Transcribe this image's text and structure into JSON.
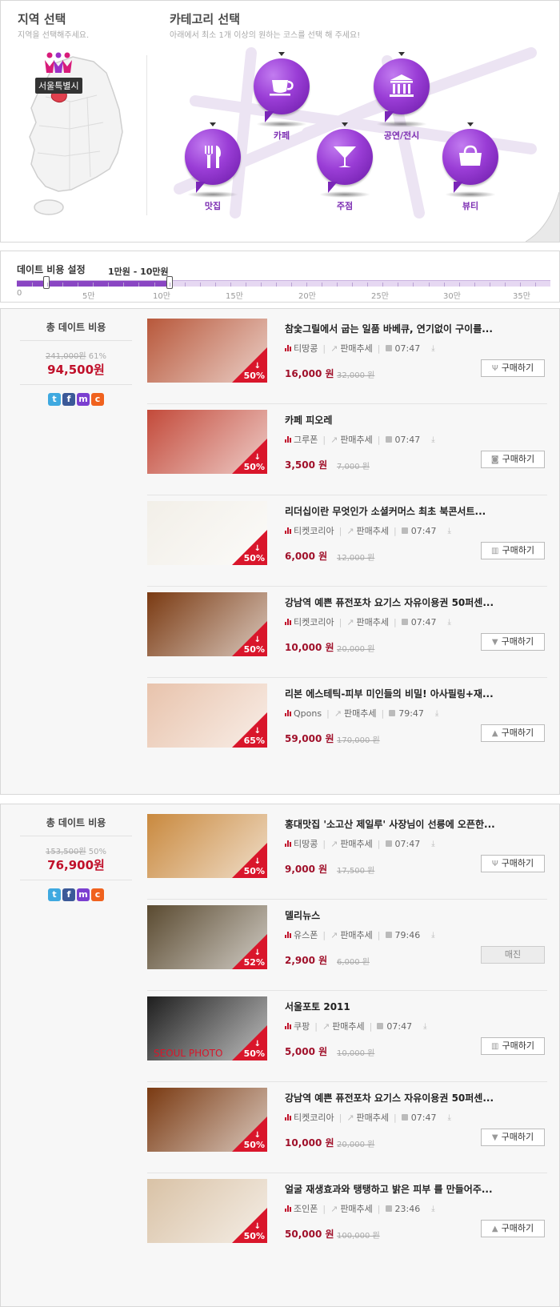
{
  "region": {
    "title": "지역 선택",
    "subtitle": "지역을 선택해주세요.",
    "selected": "서울특별시"
  },
  "category": {
    "title": "카테고리 선택",
    "subtitle": "아래에서 최소 1개 이상의 원하는 코스를 선택 해 주세요!",
    "items": [
      {
        "label": "맛집",
        "icon": "fork-knife-icon"
      },
      {
        "label": "카페",
        "icon": "coffee-cup-icon"
      },
      {
        "label": "주점",
        "icon": "cocktail-glass-icon"
      },
      {
        "label": "공연/전시",
        "icon": "museum-icon"
      },
      {
        "label": "뷰티",
        "icon": "handbag-icon"
      }
    ]
  },
  "cost": {
    "title": "데이트 비용 설정",
    "range": "1만원 - 10만원",
    "scale": [
      "0",
      "5만",
      "10만",
      "15만",
      "20만",
      "25만",
      "30만",
      "35만"
    ],
    "min_value": 1,
    "max_value": 10,
    "scale_max": 35
  },
  "courses": [
    {
      "summary_title": "총 데이트 비용",
      "original_total": "241,000원",
      "discount": "61%",
      "total": "94,500원",
      "deals": [
        {
          "title": "참숯그릴에서 굽는 일품 바베큐, 연기없이 구이를...",
          "source": "티땅콩",
          "trend": "판매추세",
          "time": "07:47",
          "price": "16,000 원",
          "original": "32,000 원",
          "discount": "50%",
          "button": "구매하기",
          "cat_icon": "fork-knife-icon",
          "thumb_color": "#b8583b",
          "sold_out": false
        },
        {
          "title": "카페 피오레",
          "source": "그루폰",
          "trend": "판매추세",
          "time": "07:47",
          "price": "3,500 원",
          "original": "7,000 원",
          "discount": "50%",
          "button": "구매하기",
          "cat_icon": "coffee-cup-icon",
          "thumb_color": "#c34a3a",
          "sold_out": false
        },
        {
          "title": "리더십이란 무엇인가 소셜커머스 최초 북콘서트...",
          "source": "티켓코리아",
          "trend": "판매추세",
          "time": "07:47",
          "price": "6,000 원",
          "original": "12,000 원",
          "discount": "50%",
          "button": "구매하기",
          "cat_icon": "museum-icon",
          "thumb_color": "#f2efe8",
          "sold_out": false
        },
        {
          "title": "강남역 예쁜 퓨전포차 요기스 자유이용권 50퍼센...",
          "source": "티켓코리아",
          "trend": "판매추세",
          "time": "07:47",
          "price": "10,000 원",
          "original": "20,000 원",
          "discount": "50%",
          "button": "구매하기",
          "cat_icon": "cocktail-glass-icon",
          "thumb_color": "#7a3a12",
          "sold_out": false
        },
        {
          "title": "리본 에스테틱-피부 미인들의 비밀! 아사필링+재...",
          "source": "Qpons",
          "trend": "판매추세",
          "time": "79:47",
          "price": "59,000 원",
          "original": "170,000 원",
          "discount": "65%",
          "button": "구매하기",
          "cat_icon": "handbag-icon",
          "thumb_color": "#e8c3ac",
          "sold_out": false
        }
      ]
    },
    {
      "summary_title": "총 데이트 비용",
      "original_total": "153,500원",
      "discount": "50%",
      "total": "76,900원",
      "deals": [
        {
          "title": "홍대맛집 '소고산 제일루' 사장님이 선릉에 오픈한...",
          "source": "티땅콩",
          "trend": "판매추세",
          "time": "07:47",
          "price": "9,000 원",
          "original": "17,500 원",
          "discount": "50%",
          "button": "구매하기",
          "cat_icon": "fork-knife-icon",
          "thumb_color": "#c9893e",
          "sold_out": false
        },
        {
          "title": "델리뉴스",
          "source": "유스폰",
          "trend": "판매추세",
          "time": "79:46",
          "price": "2,900 원",
          "original": "6,000 원",
          "discount": "52%",
          "button": "매진",
          "cat_icon": "coffee-cup-icon",
          "thumb_color": "#5a4a30",
          "sold_out": true
        },
        {
          "title": "서울포토 2011",
          "source": "쿠팡",
          "trend": "판매추세",
          "time": "07:47",
          "price": "5,000 원",
          "original": "10,000 원",
          "discount": "50%",
          "button": "구매하기",
          "cat_icon": "museum-icon",
          "thumb_color": "#1e1e1e",
          "thumb_text": "SEOUL PHOTO",
          "sold_out": false
        },
        {
          "title": "강남역 예쁜 퓨전포차 요기스 자유이용권 50퍼센...",
          "source": "티켓코리아",
          "trend": "판매추세",
          "time": "07:47",
          "price": "10,000 원",
          "original": "20,000 원",
          "discount": "50%",
          "button": "구매하기",
          "cat_icon": "cocktail-glass-icon",
          "thumb_color": "#7a3a12",
          "sold_out": false
        },
        {
          "title": "얼굴 재생효과와 탱탱하고 밝은 피부 를 만들어주...",
          "source": "조인폰",
          "trend": "판매추세",
          "time": "23:46",
          "price": "50,000 원",
          "original": "100,000 원",
          "discount": "50%",
          "button": "구매하기",
          "cat_icon": "handbag-icon",
          "thumb_color": "#d9c2a6",
          "sold_out": false
        }
      ]
    }
  ],
  "colors": {
    "accent": "#8a46c3",
    "price_red": "#c0102a",
    "badge_red": "#d9162b"
  }
}
